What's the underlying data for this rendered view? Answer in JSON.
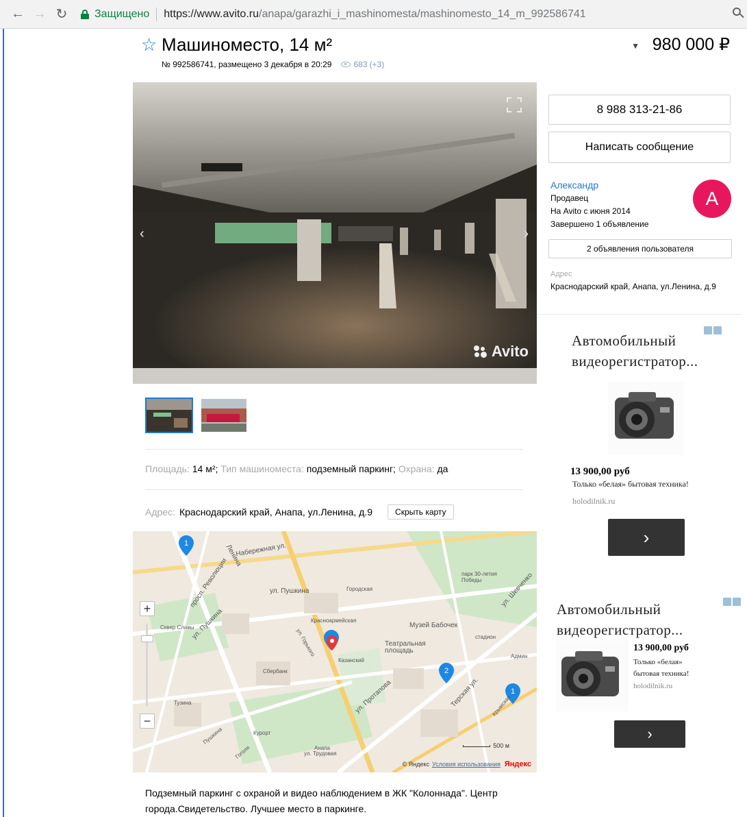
{
  "browser": {
    "secure_label": "Защищено",
    "url_main": "https://www.avito.ru",
    "url_path": "/anapa/garazhi_i_mashinomesta/mashinomesto_14_m_992586741"
  },
  "listing": {
    "title": "Машиноместо, 14 м²",
    "price": "980 000 ₽",
    "meta": "№ 992586741, размещено 3 декабря в 20:29",
    "views": "683",
    "views_delta": "(+3)",
    "watermark": "Avito",
    "params": [
      {
        "label": "Площадь:",
        "value": "14 м²;"
      },
      {
        "label": "Тип машиноместа:",
        "value": "подземный паркинг;"
      },
      {
        "label": "Охрана:",
        "value": "да"
      }
    ],
    "address_label": "Адрес:",
    "address": "Краснодарский край, Анапа, ул.Ленина, д.9",
    "hide_map": "Скрыть карту",
    "description": "Подземный паркинг с охраной и видео наблюдением в ЖК \"Колоннада\". Центр города.Свидетельство. Лучшее место в паркинге."
  },
  "map": {
    "labels": {
      "street_naberezhnaya": "Набережная ул.",
      "street_pushkina": "ул. Пушкина",
      "street_lenina": "Ленина",
      "street_revolyutsii": "просп. Революции",
      "street_pushkina2": "ул. Пушкина",
      "square_glory": "Сквер Славы",
      "park_30": "парк 30-летия Победы",
      "museum": "Музей Бабочек",
      "theatre_square": "Театральная площадь",
      "kazanski": "Казанский",
      "sberbank": "Сбербанк",
      "street_goroda": "Городская",
      "street_krasnoarmeyskaya": "Красноармейская",
      "street_protapova": "ул. Протапова",
      "street_terskaya": "Терская ул.",
      "street_shevchenko": "ул. Шевченко",
      "admin": "Админ",
      "street_krymskaya": "Крымская",
      "street_tuzina": "Тузина",
      "street_gorkogo": "ул. Горького",
      "pushkina_b": "Пушкина",
      "street_tradovaya": "ул. Трудовая",
      "gogolya": "Гоголя",
      "hotel_anapa": "Анапа",
      "kurort": "Курорт",
      "stadium": "стадион"
    },
    "zoom_in": "+",
    "zoom_out": "−",
    "scale": "500 м",
    "footer_brand": "© Яндекс",
    "footer_terms": "Условия использования",
    "footer_logo": "Яндекс",
    "pins": [
      "1",
      "2",
      "1"
    ]
  },
  "seller": {
    "phone": "8 988 313-21-86",
    "message": "Написать сообщение",
    "name": "Александр",
    "role": "Продавец",
    "since": "На Avito с июня 2014",
    "completed": "Завершено 1 объявление",
    "avatar_letter": "A",
    "user_ads": "2 объявления пользователя",
    "address_label": "Адрес",
    "address": "Краснодарский край, Анапа, ул.Ленина, д.9"
  },
  "ads": [
    {
      "heading": "Автомобильный видеорегистратор...",
      "price": "13 900,00 руб",
      "text": "Только «белая» бытовая техника!",
      "domain": "holodilnik.ru",
      "button": "›"
    },
    {
      "heading": "Автомобильный видеорегистратор...",
      "price": "13 900,00 руб",
      "text": "Только «белая» бытовая техника!",
      "domain": "holodilnik.ru",
      "button": "›"
    }
  ]
}
